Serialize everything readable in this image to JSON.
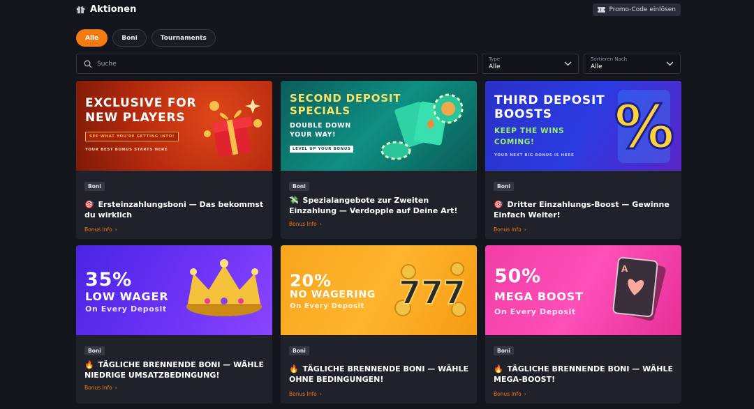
{
  "header": {
    "title": "Aktionen",
    "promo_button": "Promo-Code einlösen"
  },
  "filters": [
    {
      "label": "Alle",
      "active": true
    },
    {
      "label": "Boni",
      "active": false
    },
    {
      "label": "Tournaments",
      "active": false
    }
  ],
  "search": {
    "placeholder": "Suche",
    "value": ""
  },
  "type_select": {
    "label": "Type",
    "value": "Alle"
  },
  "sort_select": {
    "label": "Sortieren Nach",
    "value": "Alle"
  },
  "cards": [
    {
      "banner": {
        "line1": "EXCLUSIVE FOR",
        "line2": "NEW PLAYERS",
        "cta": "SEE WHAT YOU'RE GETTING INTO!",
        "tagline": "YOUR BEST BONUS STARTS HERE"
      },
      "badge": "Boni",
      "icon": "🎯",
      "title": "Ersteinzahlungsboni — Das bekommst du wirklich",
      "link": "Bonus Info"
    },
    {
      "banner": {
        "line1": "SECOND DEPOSIT",
        "line2": "SPECIALS",
        "sub1": "DOUBLE DOWN",
        "sub2": "YOUR WAY!",
        "tagline": "LEVEL UP YOUR BONUS"
      },
      "badge": "Boni",
      "icon": "💸",
      "title": "Spezialangebote zur Zweiten Einzahlung — Verdopple auf Deine Art!",
      "link": "Bonus Info"
    },
    {
      "banner": {
        "line1": "THIRD DEPOSIT",
        "line2": "BOOSTS",
        "sub1": "KEEP THE WINS",
        "sub2": "COMING!",
        "tagline": "YOUR NEXT BIG BONUS IS HERE",
        "symbol": "%"
      },
      "badge": "Boni",
      "icon": "🎯",
      "title": "Dritter Einzahlungs-Boost — Gewinne Einfach Weiter!",
      "link": "Bonus Info"
    },
    {
      "banner": {
        "line1": "35%",
        "line2": "LOW WAGER",
        "sub1": "On Every Deposit"
      },
      "badge": "Boni",
      "icon": "🔥",
      "title": "TÄGLICHE BRENNENDE BONI — WÄHLE NIEDRIGE UMSATZBEDINGUNG!",
      "link": "Bonus Info"
    },
    {
      "banner": {
        "line1": "20%",
        "line2": "NO WAGERING",
        "sub1": "On Every Deposit",
        "symbol": "777"
      },
      "badge": "Boni",
      "icon": "🔥",
      "title": "TÄGLICHE BRENNENDE BONI — WÄHLE OHNE BEDINGUNGEN!",
      "link": "Bonus Info"
    },
    {
      "banner": {
        "line1": "50%",
        "line2": "MEGA BOOST",
        "sub1": "On Every Deposit",
        "symbol": "A"
      },
      "badge": "Boni",
      "icon": "🔥",
      "title": "TÄGLICHE BRENNENDE BONI — WÄHLE MEGA-BOOST!",
      "link": "Bonus Info"
    }
  ],
  "icons": {
    "header": "gift-icon",
    "promo": "ticket-icon",
    "search": "search-icon",
    "select": "chevron-down-icon",
    "link": "chevron-right-icon"
  },
  "colors": {
    "background": "#14161d",
    "card": "#1f222b",
    "accent": "#f47b12",
    "badge": "#343844"
  }
}
